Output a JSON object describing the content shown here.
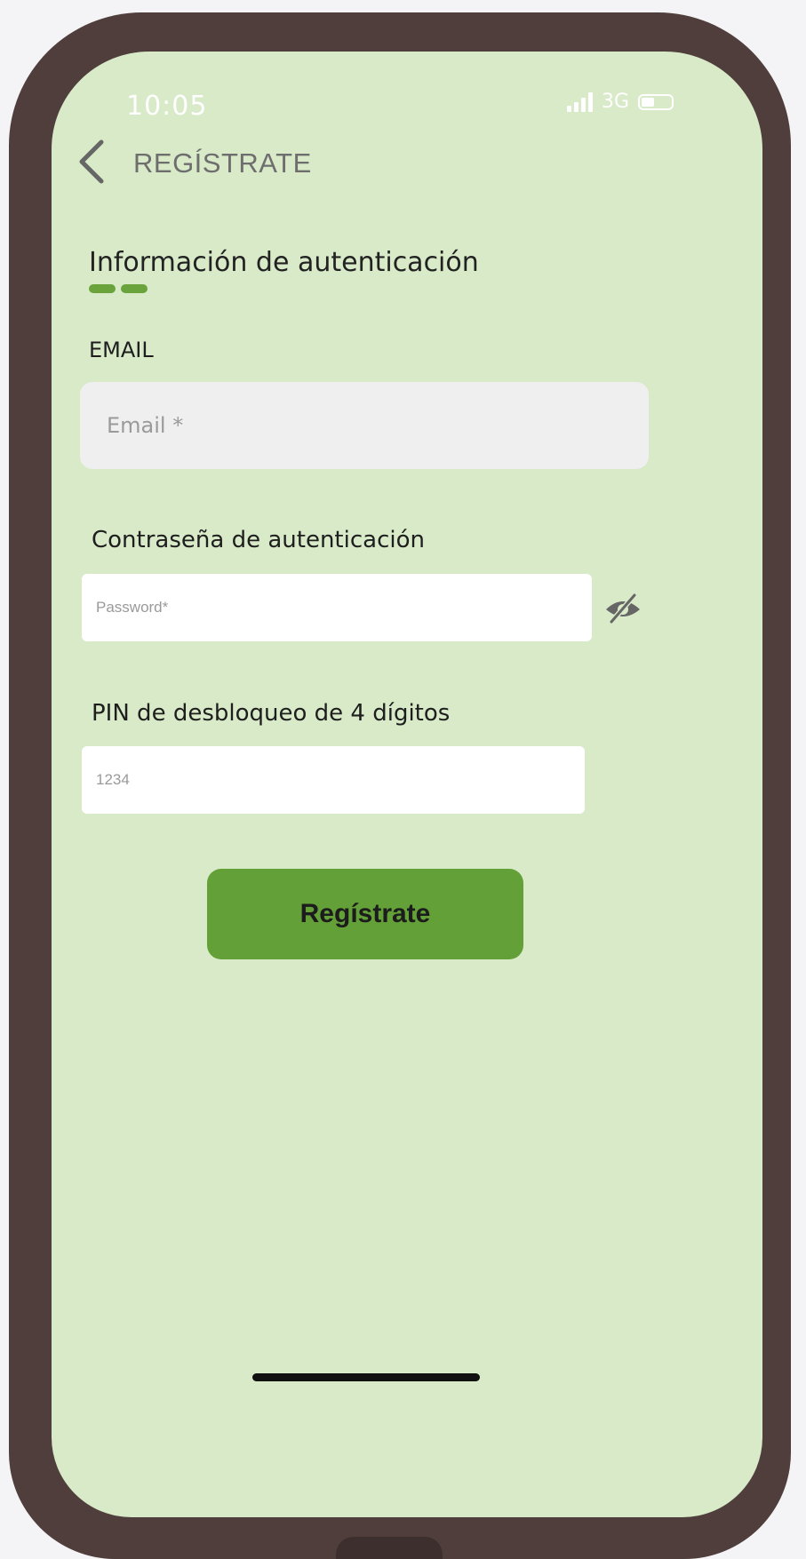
{
  "status_bar": {
    "time": "10:05",
    "network": "3G",
    "signal_icon": "signal-bars-icon",
    "battery_icon": "battery-icon"
  },
  "header": {
    "back_icon": "chevron-left-icon",
    "title": "REGÍSTRATE"
  },
  "form": {
    "section_title": "Información de autenticación",
    "email_label": "EMAIL",
    "email_placeholder": "Email *",
    "password_label": "Contraseña de autenticación",
    "password_placeholder": "Password*",
    "password_toggle_icon": "eye-off-icon",
    "pin_label": "PIN de desbloqueo de 4 dígitos",
    "pin_placeholder": "1234",
    "submit_label": "Regístrate"
  },
  "colors": {
    "accent": "#64a038",
    "screen_background": "#d8eac8",
    "frame": "#4f3e3c"
  }
}
